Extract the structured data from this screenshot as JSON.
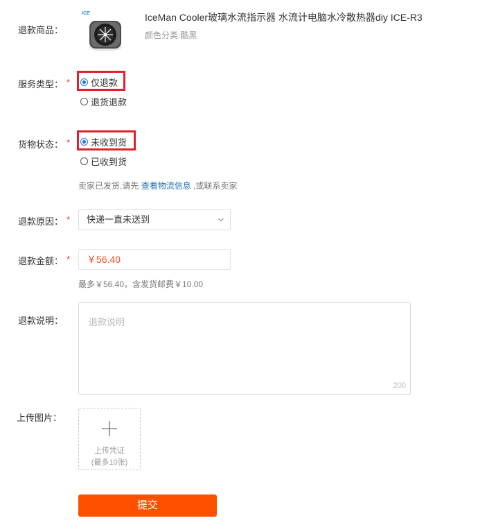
{
  "product": {
    "label": "退款商品：",
    "brand_badge": "ICE",
    "title": "IceMan Cooler玻璃水流指示器 水流计电脑水冷散热器diy ICE-R3",
    "sku": "颜色分类:酷黑"
  },
  "service_type": {
    "label": "服务类型：",
    "required_mark": "*",
    "options": [
      {
        "label": "仅退款",
        "checked": true
      },
      {
        "label": "退货退款",
        "checked": false
      }
    ]
  },
  "goods_status": {
    "label": "货物状态：",
    "required_mark": "*",
    "options": [
      {
        "label": "未收到货",
        "checked": true
      },
      {
        "label": "已收到货",
        "checked": false
      }
    ],
    "hint_prefix": "卖家已发货,请先",
    "hint_link": "查看物流信息",
    "hint_suffix": ",或联系卖家"
  },
  "refund_reason": {
    "label": "退款原因：",
    "required_mark": "*",
    "selected": "快递一直未送到"
  },
  "refund_amount": {
    "label": "退款金额：",
    "required_mark": "*",
    "value": "￥56.40",
    "hint": "最多￥56.40，含发货邮费￥10.00"
  },
  "refund_note": {
    "label": "退款说明：",
    "placeholder": "退款说明",
    "counter": "200"
  },
  "upload": {
    "label": "上传图片：",
    "line1": "上传凭证",
    "line2": "(最多10张)"
  },
  "submit_label": "提交",
  "colors": {
    "accent": "#ff5000",
    "required": "#e4393c",
    "highlight": "#e0202a",
    "link": "#1f6fb2",
    "radio": "#1a73e8"
  }
}
